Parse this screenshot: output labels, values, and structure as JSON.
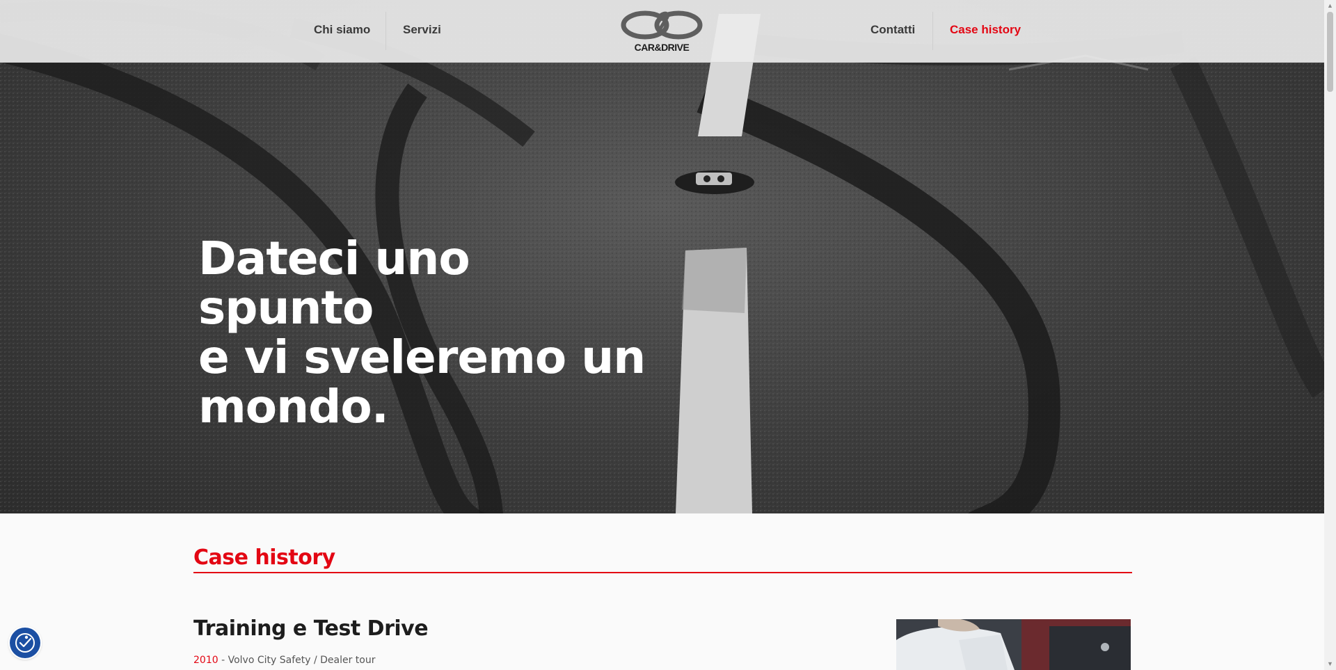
{
  "nav": {
    "left": [
      {
        "label": "Chi siamo",
        "active": false
      },
      {
        "label": "Servizi",
        "active": false
      }
    ],
    "right": [
      {
        "label": "Contatti",
        "active": false
      },
      {
        "label": "Case history",
        "active": true
      }
    ],
    "logo_text": "CAR&DRIVE",
    "active_color": "#e30613",
    "link_color": "#3a3a3a"
  },
  "hero": {
    "lines": [
      "Dateci uno",
      "spunto",
      "e vi sveleremo un",
      "mondo."
    ]
  },
  "section": {
    "title": "Case history"
  },
  "case": {
    "title": "Training e Test Drive",
    "year": "2010",
    "separator": " - ",
    "description": "Volvo City Safety / Dealer tour"
  },
  "accessibility": {
    "icon": "accessibility-icon"
  },
  "colors": {
    "accent": "#e30613",
    "a11y": "#1b4fa3"
  }
}
